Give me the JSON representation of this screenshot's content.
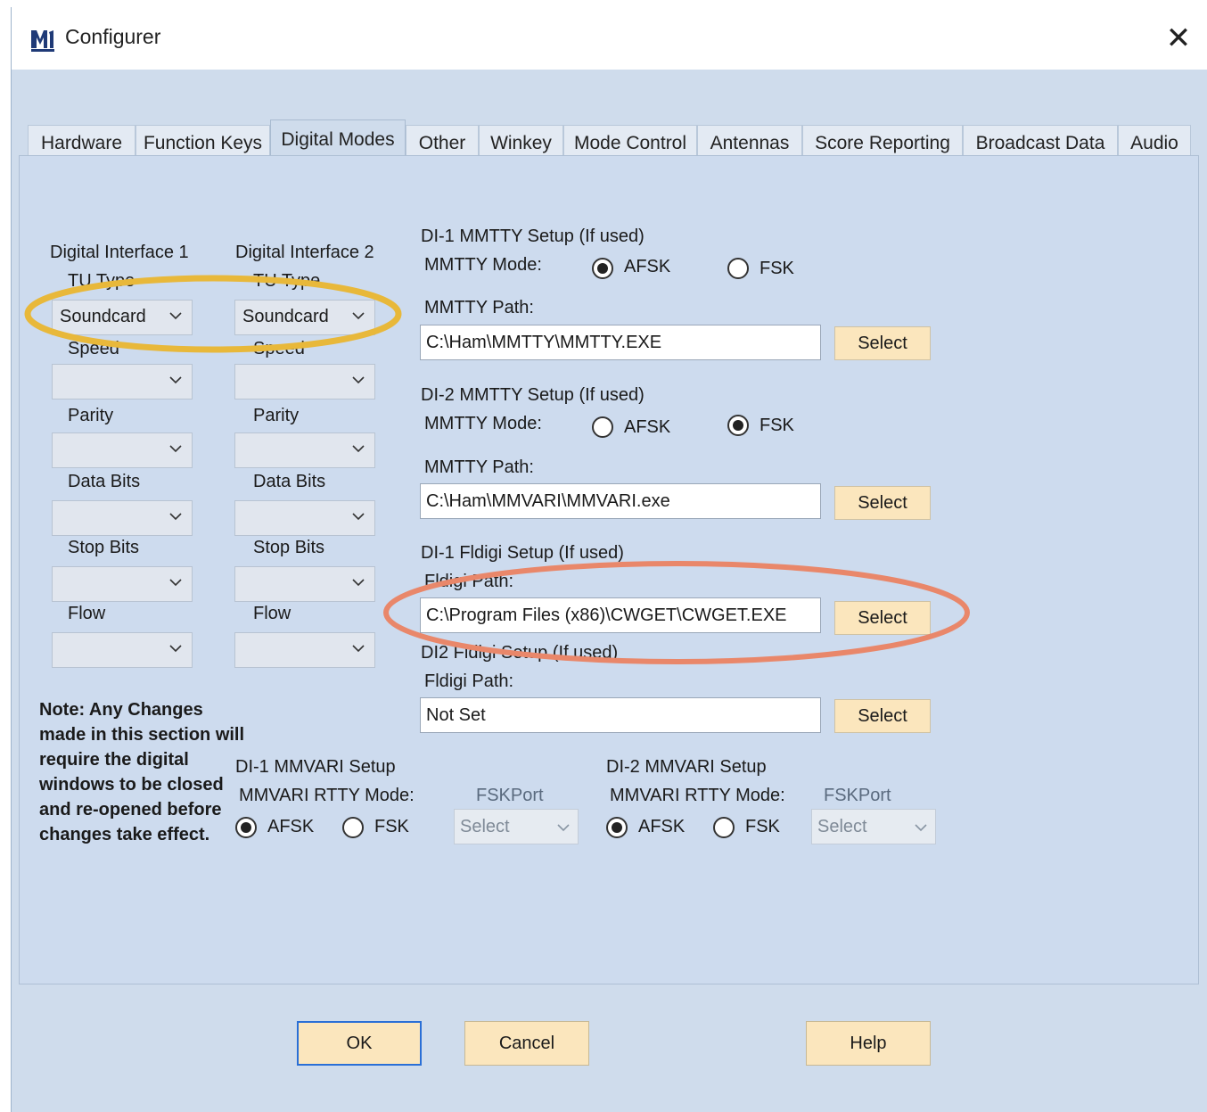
{
  "window": {
    "title": "Configurer",
    "close_glyph": "✕"
  },
  "tabs": [
    {
      "label": "Hardware"
    },
    {
      "label": "Function Keys"
    },
    {
      "label": "Digital Modes",
      "active": true
    },
    {
      "label": "Other"
    },
    {
      "label": "Winkey"
    },
    {
      "label": "Mode Control"
    },
    {
      "label": "Antennas"
    },
    {
      "label": "Score Reporting"
    },
    {
      "label": "Broadcast Data"
    },
    {
      "label": "Audio"
    }
  ],
  "interfaces": {
    "di1": {
      "heading": "Digital Interface 1",
      "tu_type_label": "TU Type",
      "tu_type_value": "Soundcard",
      "speed_label": "Speed",
      "parity_label": "Parity",
      "data_bits_label": "Data Bits",
      "stop_bits_label": "Stop Bits",
      "flow_label": "Flow"
    },
    "di2": {
      "heading": "Digital Interface 2",
      "tu_type_label": "TU Type",
      "tu_type_value": "Soundcard",
      "speed_label": "Speed",
      "parity_label": "Parity",
      "data_bits_label": "Data Bits",
      "stop_bits_label": "Stop Bits",
      "flow_label": "Flow"
    }
  },
  "mmtty1": {
    "heading": "DI-1 MMTTY Setup (If used)",
    "mode_label": "MMTTY Mode:",
    "afsk_label": "AFSK",
    "fsk_label": "FSK",
    "selected": "AFSK",
    "path_label": "MMTTY Path:",
    "path_value": "C:\\Ham\\MMTTY\\MMTTY.EXE",
    "select_label": "Select"
  },
  "mmtty2": {
    "heading": "DI-2 MMTTY Setup (If used)",
    "mode_label": "MMTTY Mode:",
    "afsk_label": "AFSK",
    "fsk_label": "FSK",
    "selected": "FSK",
    "path_label": "MMTTY Path:",
    "path_value": "C:\\Ham\\MMVARI\\MMVARI.exe",
    "select_label": "Select"
  },
  "fldigi1": {
    "heading": "DI-1 Fldigi Setup (If used)",
    "path_label": "Fldigi Path:",
    "path_value": "C:\\Program Files (x86)\\CWGET\\CWGET.EXE",
    "select_label": "Select"
  },
  "fldigi2": {
    "heading": "DI2 Fldigi Setup (If used)",
    "path_label": "Fldigi Path:",
    "path_value": "Not Set",
    "select_label": "Select"
  },
  "mmvari1": {
    "heading": "DI-1 MMVARI Setup",
    "mode_label": "MMVARI RTTY Mode:",
    "afsk_label": "AFSK",
    "fsk_label": "FSK",
    "selected": "AFSK",
    "fskport_label": "FSKPort",
    "fskport_value": "Select"
  },
  "mmvari2": {
    "heading": "DI-2 MMVARI Setup",
    "mode_label": "MMVARI RTTY Mode:",
    "afsk_label": "AFSK",
    "fsk_label": "FSK",
    "selected": "AFSK",
    "fskport_label": "FSKPort",
    "fskport_value": "Select"
  },
  "note": "Note: Any Changes made in this section will require the digital windows to be closed and re-opened before changes take effect.",
  "buttons": {
    "ok": "OK",
    "cancel": "Cancel",
    "help": "Help"
  },
  "colors": {
    "highlight_yellow": "#e8b83a",
    "highlight_orange": "#e9876a",
    "button_face": "#fbe6bd",
    "panel_bg": "#cddbee"
  }
}
